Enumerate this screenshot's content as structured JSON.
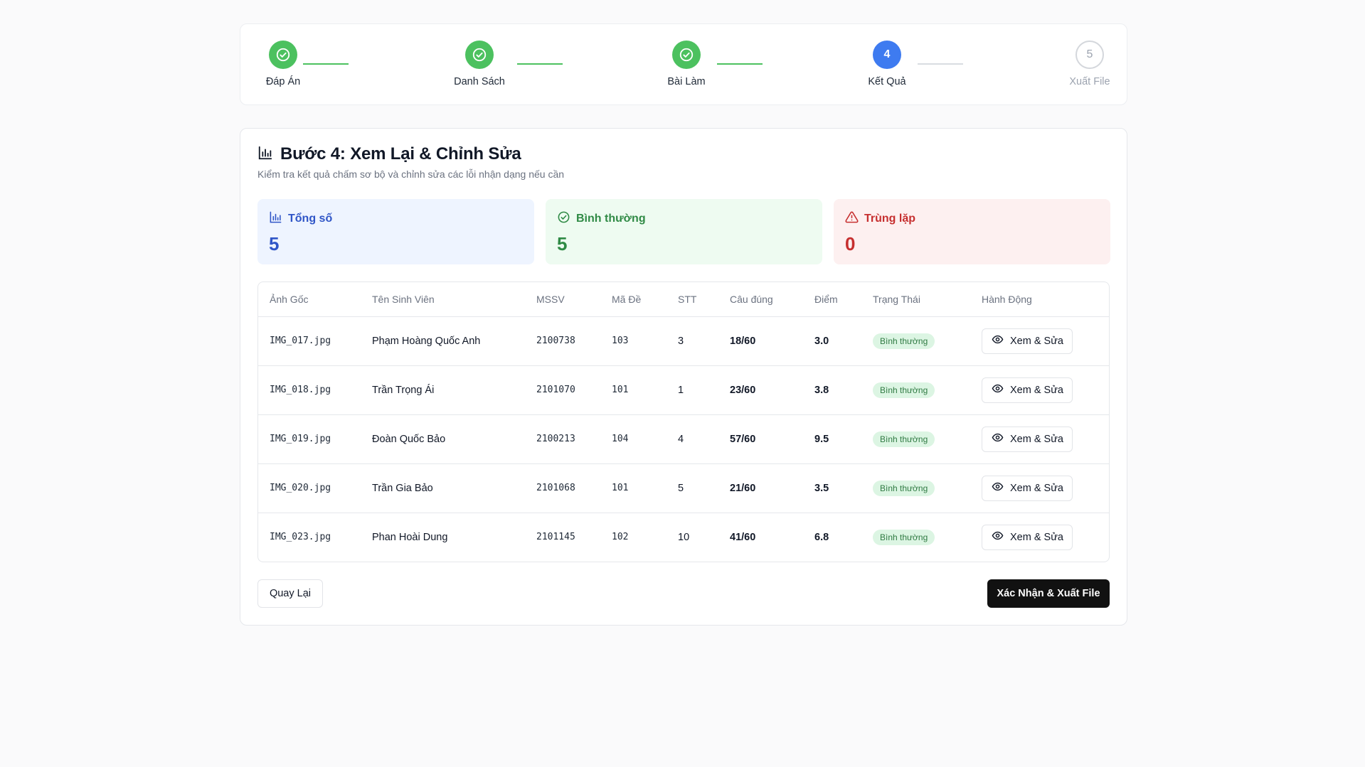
{
  "stepper": {
    "steps": [
      {
        "label": "Đáp Án",
        "state": "done",
        "number": ""
      },
      {
        "label": "Danh Sách",
        "state": "done",
        "number": ""
      },
      {
        "label": "Bài Làm",
        "state": "done",
        "number": ""
      },
      {
        "label": "Kết Quả",
        "state": "active",
        "number": "4"
      },
      {
        "label": "Xuất File",
        "state": "pending",
        "number": "5"
      }
    ]
  },
  "header": {
    "title": "Bước 4: Xem Lại & Chỉnh Sửa",
    "subtitle": "Kiểm tra kết quả chấm sơ bộ và chỉnh sửa các lỗi nhận dạng nếu cần",
    "title_icon": "bar-chart-icon"
  },
  "stats": {
    "total": {
      "label": "Tổng số",
      "value": "5",
      "icon": "bar-chart-icon",
      "color": "#2f55c7"
    },
    "normal": {
      "label": "Bình thường",
      "value": "5",
      "icon": "check-circle-icon",
      "color": "#2f8a45"
    },
    "duplicate": {
      "label": "Trùng lặp",
      "value": "0",
      "icon": "warning-icon",
      "color": "#c62f2f"
    }
  },
  "table": {
    "columns": [
      "Ảnh Gốc",
      "Tên Sinh Viên",
      "MSSV",
      "Mã Đề",
      "STT",
      "Câu đúng",
      "Điểm",
      "Trạng Thái",
      "Hành Động"
    ],
    "rows": [
      {
        "image": "IMG_017.jpg",
        "name": "Phạm Hoàng Quốc Anh",
        "mssv": "2100738",
        "code": "103",
        "stt": "3",
        "correct": "18/60",
        "score": "3.0",
        "status": "Bình thường",
        "action": "Xem & Sửa"
      },
      {
        "image": "IMG_018.jpg",
        "name": "Trần Trọng Ái",
        "mssv": "2101070",
        "code": "101",
        "stt": "1",
        "correct": "23/60",
        "score": "3.8",
        "status": "Bình thường",
        "action": "Xem & Sửa"
      },
      {
        "image": "IMG_019.jpg",
        "name": "Đoàn Quốc Bảo",
        "mssv": "2100213",
        "code": "104",
        "stt": "4",
        "correct": "57/60",
        "score": "9.5",
        "status": "Bình thường",
        "action": "Xem & Sửa"
      },
      {
        "image": "IMG_020.jpg",
        "name": "Trần Gia Bảo",
        "mssv": "2101068",
        "code": "101",
        "stt": "5",
        "correct": "21/60",
        "score": "3.5",
        "status": "Bình thường",
        "action": "Xem & Sửa"
      },
      {
        "image": "IMG_023.jpg",
        "name": "Phan Hoài Dung",
        "mssv": "2101145",
        "code": "102",
        "stt": "10",
        "correct": "41/60",
        "score": "6.8",
        "status": "Bình thường",
        "action": "Xem & Sửa"
      }
    ]
  },
  "footer": {
    "back_label": "Quay Lại",
    "confirm_label": "Xác Nhận & Xuất File"
  },
  "colors": {
    "done": "#4cc15f",
    "active": "#3e7bf0",
    "primary_button": "#111111"
  }
}
